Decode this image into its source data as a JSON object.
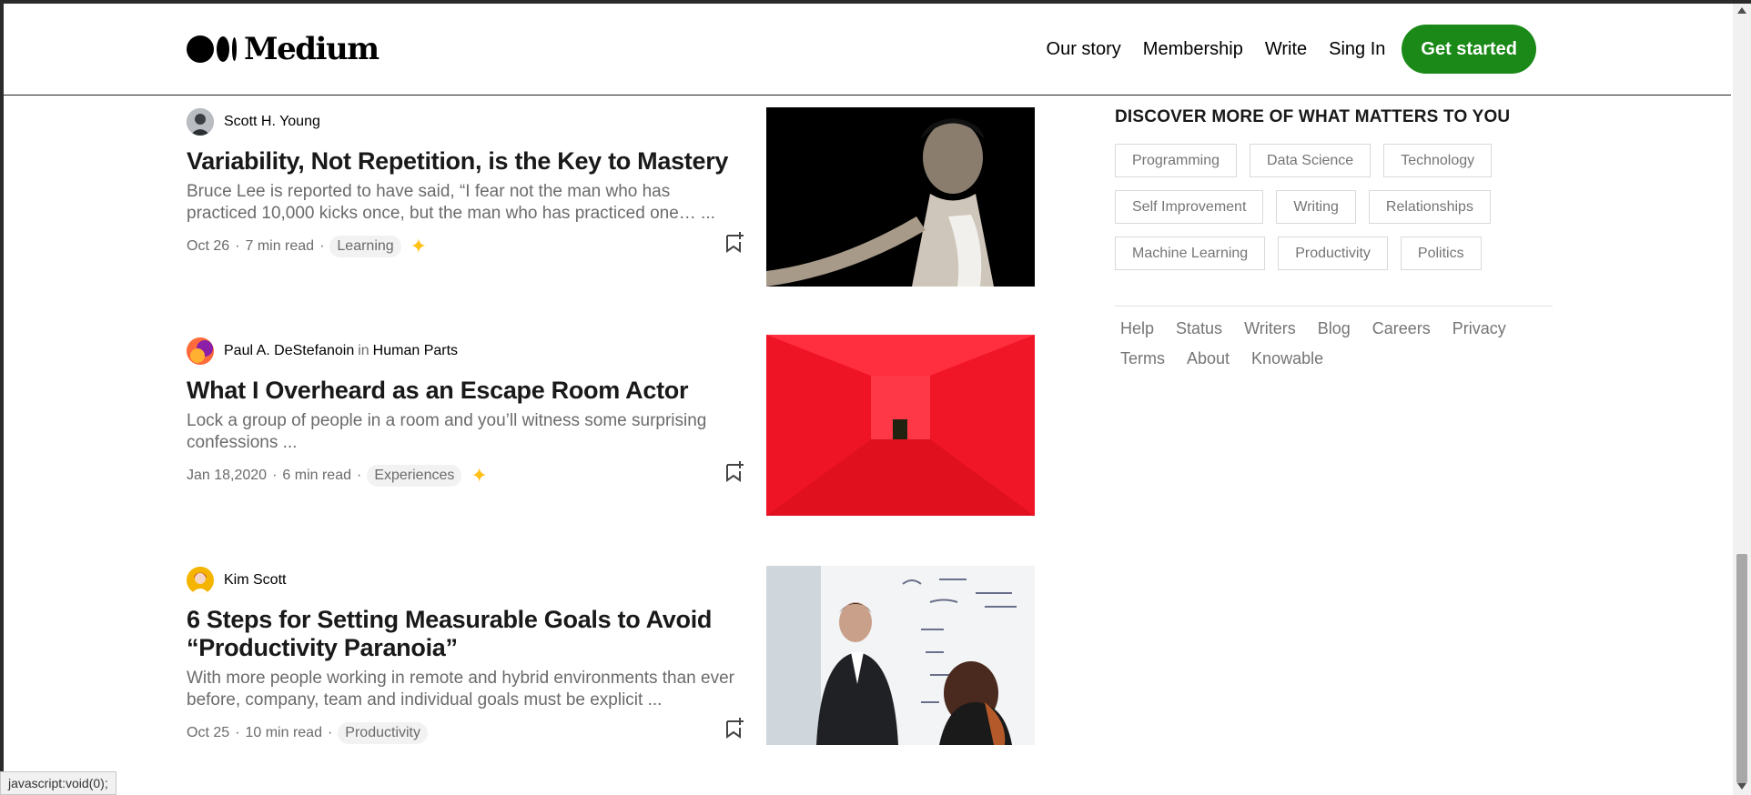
{
  "header": {
    "logo_text": "Medium",
    "nav": [
      "Our story",
      "Membership",
      "Write",
      "Sing In"
    ],
    "cta_label": "Get started"
  },
  "colors": {
    "accent_green": "#1a8917",
    "member_star": "#ffc017"
  },
  "articles": [
    {
      "author": "Scott H. Young",
      "publication": "",
      "title": "Variability, Not Repetition, is the Key to Mastery",
      "excerpt": "Bruce Lee is reported to have said, “I fear not the man who has practiced 10,000 kicks once, but the man who has practiced one… ...",
      "date": "Oct 26",
      "read_time": "7 min read",
      "tag": "Learning",
      "member_only": true,
      "image": "bruce-lee-figure"
    },
    {
      "author": "Paul A. DeStefanoin",
      "in_label": "in",
      "publication": "Human Parts",
      "title": "What I Overheard as an Escape Room Actor",
      "excerpt": "Lock a group of people in a room and you’ll witness some surprising confessions ...",
      "date": "Jan 18,2020",
      "read_time": "6 min read",
      "tag": "Experiences",
      "member_only": true,
      "image": "red-room-chair"
    },
    {
      "author": "Kim Scott",
      "publication": "",
      "title": "6 Steps for Setting Measurable Goals to Avoid “Productivity Paranoia”",
      "excerpt": "With more people working in remote and hybrid environments than ever before, company, team and individual goals must be explicit ...",
      "date": "Oct 25",
      "read_time": "10 min read",
      "tag": "Productivity",
      "member_only": false,
      "image": "whiteboard-meeting"
    }
  ],
  "sidebar": {
    "title": "DISCOVER MORE OF WHAT MATTERS TO YOU",
    "topics": [
      "Programming",
      "Data Science",
      "Technology",
      "Self Improvement",
      "Writing",
      "Relationships",
      "Machine Learning",
      "Productivity",
      "Politics"
    ],
    "footer_links": [
      "Help",
      "Status",
      "Writers",
      "Blog",
      "Careers",
      "Privacy",
      "Terms",
      "About",
      "Knowable"
    ]
  },
  "status_bar": {
    "text": "javascript:void(0);"
  },
  "meta_separator": "·"
}
